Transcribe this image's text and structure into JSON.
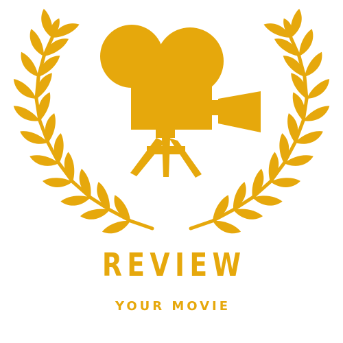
{
  "logo": {
    "title": "REVIEW",
    "subtitle": "YOUR MOVIE",
    "icon": "movie-camera-icon",
    "wreath": "laurel-wreath-icon",
    "colors": {
      "gold": "#E6A80C",
      "background": "#FFFFFF"
    }
  }
}
